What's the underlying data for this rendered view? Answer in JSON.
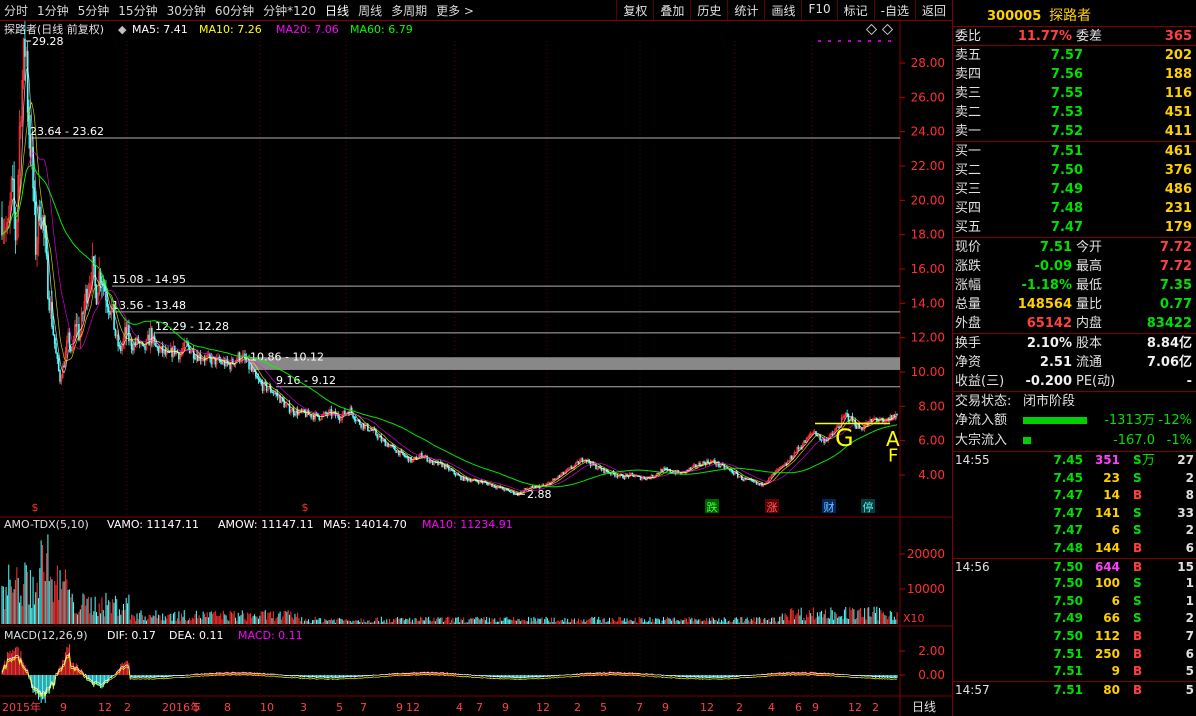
{
  "toolbar": {
    "timeframes": [
      "分时",
      "1分钟",
      "5分钟",
      "15分钟",
      "30分钟",
      "60分钟",
      "分钟*120",
      "日线",
      "周线",
      "多周期",
      "更多 >"
    ],
    "active_timeframe": "日线",
    "buttons": [
      "复权",
      "叠加",
      "历史",
      "统计",
      "画线",
      "F10",
      "标记",
      "-自选",
      "返回"
    ]
  },
  "main_panel": {
    "legend_name": "探路者(日线 前复权)",
    "ma5": "MA5: 7.41",
    "ma10": "MA10: 7.26",
    "ma20": "MA20: 7.06",
    "ma60": "MA60: 6.79",
    "y_ticks": [
      "28.00",
      "26.00",
      "24.00",
      "22.00",
      "20.00",
      "18.00",
      "16.00",
      "14.00",
      "12.00",
      "10.00",
      "8.00",
      "6.00",
      "4.00"
    ],
    "peak_label": "29.28",
    "low_label": "2.88",
    "level_labels": [
      "23.64 - 23.62",
      "15.08 - 14.95",
      "13.56 - 13.48",
      "12.29 - 12.28",
      "10.86 - 10.12",
      "9.16 - 9.12"
    ],
    "markers": [
      "跌",
      "涨",
      "财",
      "停"
    ],
    "marker_s": "$",
    "signal_letters": [
      "G",
      "A",
      "F"
    ]
  },
  "volume_panel": {
    "indicator": "AMO-TDX(5,10)",
    "vamo": "VAMO: 11147.11",
    "amow": "AMOW: 11147.11",
    "ma5": "MA5: 14014.70",
    "ma10": "MA10: 11234.91",
    "y_ticks": [
      "20000",
      "10000"
    ],
    "unit": "X10"
  },
  "macd_panel": {
    "indicator": "MACD(12,26,9)",
    "dif": "DIF: 0.17",
    "dea": "DEA: 0.11",
    "macd": "MACD: 0.11",
    "y_ticks": [
      "2.00",
      "0.00"
    ]
  },
  "x_axis": {
    "labels": [
      "2015年",
      "9",
      "12",
      "2",
      "2016年",
      "5",
      "8",
      "10",
      "3",
      "5",
      "7",
      "9",
      "12",
      "4",
      "7",
      "9",
      "12",
      "2",
      "5",
      "7",
      "9",
      "12",
      "2",
      "4",
      "6",
      "9",
      "12",
      "2"
    ],
    "period": "日线"
  },
  "quote": {
    "code": "300005",
    "name": "探路者",
    "weibi_label": "委比",
    "weibi": "11.77%",
    "weicha_label": "委差",
    "weicha": "365",
    "sells": [
      {
        "label": "卖五",
        "price": "7.57",
        "qty": "202"
      },
      {
        "label": "卖四",
        "price": "7.56",
        "qty": "188"
      },
      {
        "label": "卖三",
        "price": "7.55",
        "qty": "116"
      },
      {
        "label": "卖二",
        "price": "7.53",
        "qty": "451"
      },
      {
        "label": "卖一",
        "price": "7.52",
        "qty": "411"
      }
    ],
    "buys": [
      {
        "label": "买一",
        "price": "7.51",
        "qty": "461"
      },
      {
        "label": "买二",
        "price": "7.50",
        "qty": "376"
      },
      {
        "label": "买三",
        "price": "7.49",
        "qty": "486"
      },
      {
        "label": "买四",
        "price": "7.48",
        "qty": "231"
      },
      {
        "label": "买五",
        "price": "7.47",
        "qty": "179"
      }
    ],
    "stats1": [
      {
        "l1": "现价",
        "v1": "7.51",
        "c1": "green",
        "l2": "今开",
        "v2": "7.72",
        "c2": "red"
      },
      {
        "l1": "涨跌",
        "v1": "-0.09",
        "c1": "green",
        "l2": "最高",
        "v2": "7.72",
        "c2": "red"
      },
      {
        "l1": "涨幅",
        "v1": "-1.18%",
        "c1": "green",
        "l2": "最低",
        "v2": "7.35",
        "c2": "green"
      },
      {
        "l1": "总量",
        "v1": "148564",
        "c1": "yellow",
        "l2": "量比",
        "v2": "0.77",
        "c2": "green"
      },
      {
        "l1": "外盘",
        "v1": "65142",
        "c1": "red",
        "l2": "内盘",
        "v2": "83422",
        "c2": "green"
      }
    ],
    "stats2": [
      {
        "l1": "换手",
        "v1": "2.10%",
        "c1": "white",
        "l2": "股本",
        "v2": "8.84亿",
        "c2": "white"
      },
      {
        "l1": "净资",
        "v1": "2.51",
        "c1": "white",
        "l2": "流通",
        "v2": "7.06亿",
        "c2": "white"
      },
      {
        "l1": "收益(三)",
        "v1": "-0.200",
        "c1": "white",
        "l2": "PE(动)",
        "v2": "-",
        "c2": "white"
      }
    ],
    "status_label": "交易状态:",
    "status_value": "闭市阶段",
    "flows": [
      {
        "label": "净流入额",
        "bar_frac": 1.0,
        "value": "-1313万",
        "pct": "-12%"
      },
      {
        "label": "大宗流入",
        "bar_frac": 0.12,
        "value": "-167.0万",
        "pct": "-1%"
      }
    ],
    "ticks": [
      {
        "time": "14:55",
        "price": "7.45",
        "vol": "351",
        "vcolor": "magenta",
        "bs": "S",
        "n": "27",
        "sep": false
      },
      {
        "time": "",
        "price": "7.45",
        "vol": "23",
        "vcolor": "yellow",
        "bs": "S",
        "n": "2",
        "sep": false
      },
      {
        "time": "",
        "price": "7.47",
        "vol": "14",
        "vcolor": "yellow",
        "bs": "B",
        "n": "8",
        "sep": false
      },
      {
        "time": "",
        "price": "7.47",
        "vol": "141",
        "vcolor": "yellow",
        "bs": "S",
        "n": "33",
        "sep": false
      },
      {
        "time": "",
        "price": "7.47",
        "vol": "6",
        "vcolor": "yellow",
        "bs": "S",
        "n": "2",
        "sep": false
      },
      {
        "time": "",
        "price": "7.48",
        "vol": "144",
        "vcolor": "yellow",
        "bs": "B",
        "n": "6",
        "sep": false
      },
      {
        "time": "14:56",
        "price": "7.50",
        "vol": "644",
        "vcolor": "magenta",
        "bs": "B",
        "n": "15",
        "sep": true
      },
      {
        "time": "",
        "price": "7.50",
        "vol": "100",
        "vcolor": "yellow",
        "bs": "S",
        "n": "1",
        "sep": false
      },
      {
        "time": "",
        "price": "7.50",
        "vol": "6",
        "vcolor": "yellow",
        "bs": "S",
        "n": "1",
        "sep": false
      },
      {
        "time": "",
        "price": "7.49",
        "vol": "66",
        "vcolor": "yellow",
        "bs": "S",
        "n": "2",
        "sep": false
      },
      {
        "time": "",
        "price": "7.50",
        "vol": "112",
        "vcolor": "yellow",
        "bs": "B",
        "n": "7",
        "sep": false
      },
      {
        "time": "",
        "price": "7.51",
        "vol": "250",
        "vcolor": "yellow",
        "bs": "B",
        "n": "6",
        "sep": false
      },
      {
        "time": "",
        "price": "7.51",
        "vol": "9",
        "vcolor": "yellow",
        "bs": "B",
        "n": "5",
        "sep": false
      },
      {
        "time": "14:57",
        "price": "7.51",
        "vol": "80",
        "vcolor": "yellow",
        "bs": "B",
        "n": "5",
        "sep": true
      }
    ]
  },
  "colors": {
    "up": "#ff3232",
    "down": "#54ffff",
    "ma5": "#ffffff",
    "ma10": "#ffff00",
    "ma20": "#ff00ff",
    "ma60": "#00ff00",
    "grid": "#800000"
  }
}
